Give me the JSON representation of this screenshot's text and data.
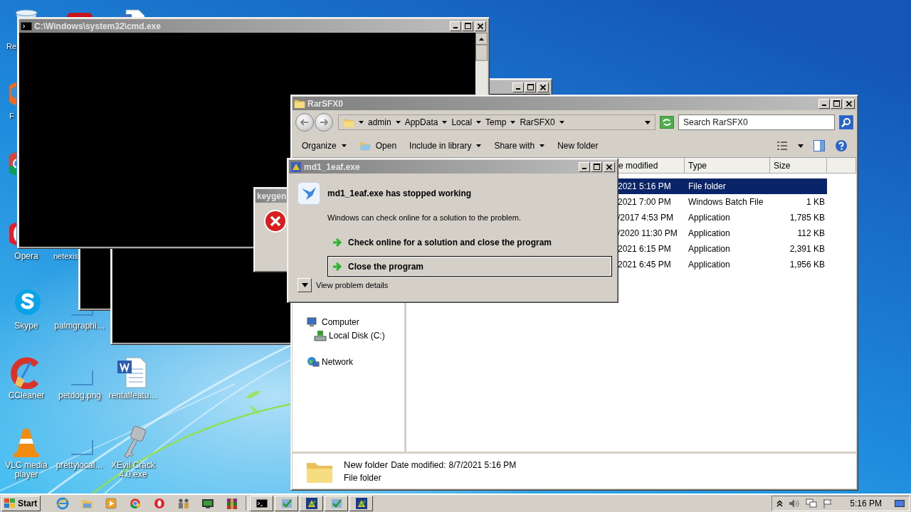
{
  "desktop_icons": [
    {
      "kind": "recycle-bin",
      "label": "Re"
    },
    {
      "kind": "red-app"
    },
    {
      "kind": "document"
    },
    {
      "kind": "orange-app",
      "label": "F"
    },
    {
      "kind": "chrome"
    },
    {
      "kind": "opera",
      "label": "Opera"
    },
    {
      "label": "netexis"
    },
    {
      "kind": "skype",
      "label": "Skype"
    },
    {
      "kind": "blank-file",
      "label": "palmgraphi…"
    },
    {
      "kind": "ccleaner",
      "label": "CCleaner"
    },
    {
      "kind": "blank-file",
      "label": "petdog.png"
    },
    {
      "kind": "word-doc",
      "label": "rentalfeatu…"
    },
    {
      "kind": "vlc",
      "label": "VLC media player"
    },
    {
      "kind": "blank-file",
      "label": "prettylocal…"
    },
    {
      "kind": "key",
      "label": "XEvil Crack 4.0.exe"
    }
  ],
  "cmd_window": {
    "title": "C:\\Windows\\system32\\cmd.exe"
  },
  "keygen_dialog": {
    "title": "keygen"
  },
  "explorer": {
    "title": "RarSFX0",
    "breadcrumb": [
      "admin",
      "AppData",
      "Local",
      "Temp",
      "RarSFX0"
    ],
    "search": {
      "placeholder": "Search RarSFX0"
    },
    "toolbar": [
      {
        "kind": "menu",
        "label": "Organize"
      },
      {
        "kind": "icon",
        "label": "Open"
      },
      {
        "kind": "menu",
        "label": "Include in library"
      },
      {
        "kind": "menu",
        "label": "Share with"
      },
      {
        "kind": "plain",
        "label": "New folder"
      }
    ],
    "columns": [
      "e modified",
      "Type",
      "Size"
    ],
    "rows": [
      {
        "modified": "2021 5:16 PM",
        "type": "File folder",
        "selected": true
      },
      {
        "modified": "2021 7:00 PM",
        "type": "Windows Batch File",
        "size": "1 KB",
        "selected": false
      },
      {
        "modified": "/2017 4:53 PM",
        "type": "Application",
        "size": "1,785 KB",
        "selected": false
      },
      {
        "modified": "/2020 11:30 PM",
        "type": "Application",
        "size": "112 KB",
        "selected": false
      },
      {
        "modified": "2021 6:15 PM",
        "type": "Application",
        "size": "2,391 KB",
        "selected": false
      },
      {
        "modified": "2021 6:45 PM",
        "type": "Application",
        "size": "1,956 KB",
        "selected": false
      }
    ],
    "nav": [
      {
        "kind": "computer",
        "label": "Computer",
        "children": [
          {
            "kind": "disk",
            "label": "Local Disk (C:)"
          }
        ]
      },
      {
        "kind": "network",
        "label": "Network"
      }
    ],
    "details": {
      "name": "New folder",
      "date_label": "Date modified:",
      "date": "8/7/2021 5:16 PM",
      "type": "File folder"
    }
  },
  "crash_dialog": {
    "title": "md1_1eaf.exe",
    "heading": "md1_1eaf.exe has stopped working",
    "message": "Windows can check online for a solution to the problem.",
    "options": [
      {
        "label": "Check online for a solution and close the program",
        "selected": false
      },
      {
        "label": "Close the program",
        "selected": true
      }
    ],
    "details_toggle": {
      "label": "View problem details",
      "expanded": false
    }
  },
  "taskbar": {
    "start": "Start",
    "items": [
      {
        "kind": "ie"
      },
      {
        "kind": "explorer"
      },
      {
        "kind": "media"
      },
      {
        "kind": "chrome"
      },
      {
        "kind": "opera"
      },
      {
        "kind": "people"
      },
      {
        "kind": "monitor"
      },
      {
        "kind": "winrar"
      }
    ],
    "tasks": [
      {
        "kind": "cmd"
      },
      {
        "kind": "check-app"
      },
      {
        "kind": "setup-app"
      },
      {
        "kind": "check-app"
      },
      {
        "kind": "setup-app"
      }
    ],
    "clock": "5:16 PM"
  }
}
